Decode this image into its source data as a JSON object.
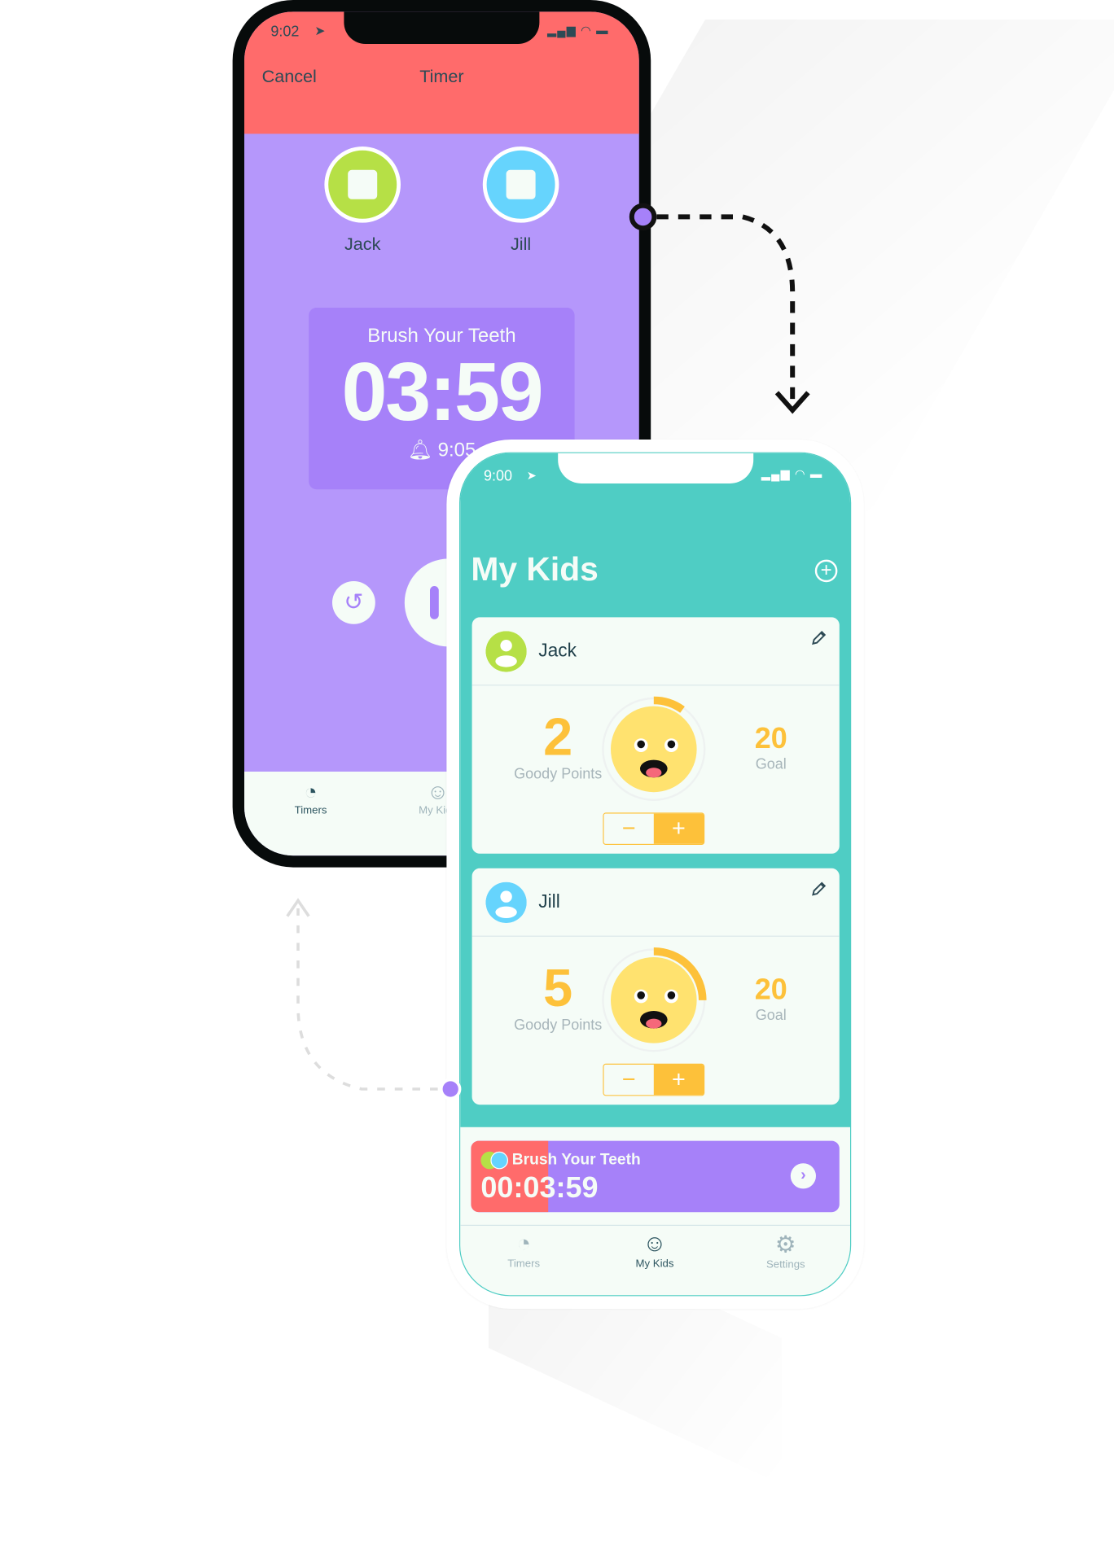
{
  "colors": {
    "coral": "#FF6B6B",
    "purple": "#B597FB",
    "purple_dark": "#A681F9",
    "teal": "#4FCDC4",
    "yellow": "#FDC13A",
    "green": "#B6E046",
    "blue": "#66D4FD"
  },
  "timer_screen": {
    "status_time": "9:02",
    "nav": {
      "cancel": "Cancel",
      "title": "Timer"
    },
    "kids": [
      {
        "name": "Jack",
        "color": "#B6E046",
        "icon": "stop-icon"
      },
      {
        "name": "Jill",
        "color": "#66D4FD",
        "icon": "stop-icon"
      }
    ],
    "timer": {
      "title": "Brush Your Teeth",
      "remaining": "03:59",
      "alarm": "9:05"
    },
    "controls": {
      "reset_icon": "reset-icon",
      "pause_icon": "pause-icon"
    },
    "tabs": [
      {
        "label": "Timers",
        "icon": "timer-icon",
        "active": true
      },
      {
        "label": "My Kids",
        "icon": "smiley-icon",
        "active": false
      }
    ]
  },
  "kids_screen": {
    "status_time": "9:00",
    "title": "My Kids",
    "add_icon": "plus-circle-icon",
    "kids": [
      {
        "name": "Jack",
        "color": "#B6E046",
        "points": 2,
        "points_label": "Goody Points",
        "goal": 20,
        "goal_label": "Goal",
        "minus": "−",
        "plus": "+"
      },
      {
        "name": "Jill",
        "color": "#66D4FD",
        "points": 5,
        "points_label": "Goody Points",
        "goal": 20,
        "goal_label": "Goal",
        "minus": "−",
        "plus": "+"
      }
    ],
    "active_timer": {
      "title": "Brush Your Teeth",
      "remaining": "00:03:59",
      "progress": 0.21
    },
    "tabs": [
      {
        "label": "Timers",
        "icon": "timer-icon",
        "active": false
      },
      {
        "label": "My Kids",
        "icon": "smiley-icon",
        "active": true
      },
      {
        "label": "Settings",
        "icon": "gear-icon",
        "active": false
      }
    ]
  }
}
